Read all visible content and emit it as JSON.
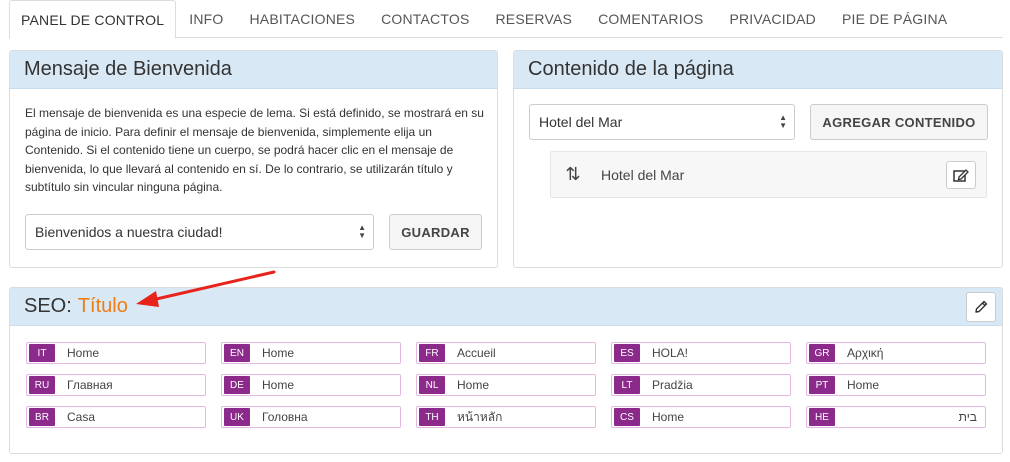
{
  "tabs": [
    "PANEL DE CONTROL",
    "INFO",
    "HABITACIONES",
    "CONTACTOS",
    "RESERVAS",
    "COMENTARIOS",
    "PRIVACIDAD",
    "PIE DE PÁGINA"
  ],
  "welcome": {
    "title": "Mensaje de Bienvenida",
    "description": "El mensaje de bienvenida es una especie de lema. Si está definido, se mostrará en su página de inicio. Para definir el mensaje de bienvenida, simplemente elija un Contenido. Si el contenido tiene un cuerpo, se podrá hacer clic en el mensaje de bienvenida, lo que llevará al contenido en sí. De lo contrario, se utilizarán título y subtítulo sin vincular ninguna página.",
    "select_value": "Bienvenidos a nuestra ciudad!",
    "save_label": "GUARDAR"
  },
  "content": {
    "title": "Contenido de la página",
    "select_value": "Hotel del Mar",
    "add_label": "AGREGAR CONTENIDO",
    "items": [
      {
        "label": "Hotel del Mar"
      }
    ]
  },
  "seo": {
    "prefix": "SEO:",
    "accent": "Título",
    "accent_color": "#f07c14",
    "languages": [
      {
        "code": "IT",
        "value": "Home"
      },
      {
        "code": "EN",
        "value": "Home"
      },
      {
        "code": "FR",
        "value": "Accueil"
      },
      {
        "code": "ES",
        "value": "HOLA!"
      },
      {
        "code": "GR",
        "value": "Αρχική"
      },
      {
        "code": "RU",
        "value": "Главная"
      },
      {
        "code": "DE",
        "value": "Home"
      },
      {
        "code": "NL",
        "value": "Home"
      },
      {
        "code": "LT",
        "value": "Pradžia"
      },
      {
        "code": "PT",
        "value": "Home"
      },
      {
        "code": "BR",
        "value": "Casa"
      },
      {
        "code": "UK",
        "value": "Головна"
      },
      {
        "code": "TH",
        "value": "หน้าหลัก"
      },
      {
        "code": "CS",
        "value": "Home"
      },
      {
        "code": "HE",
        "value": "בית"
      }
    ]
  },
  "icons": {
    "sort": "sort-arrows-icon",
    "edit": "edit-icon",
    "pencil": "pencil-icon",
    "annotation": "red-arrow"
  },
  "colors": {
    "panel_header": "#d9e8f5",
    "language_badge": "#8b2a8b",
    "annotation_arrow": "#e8231b"
  }
}
